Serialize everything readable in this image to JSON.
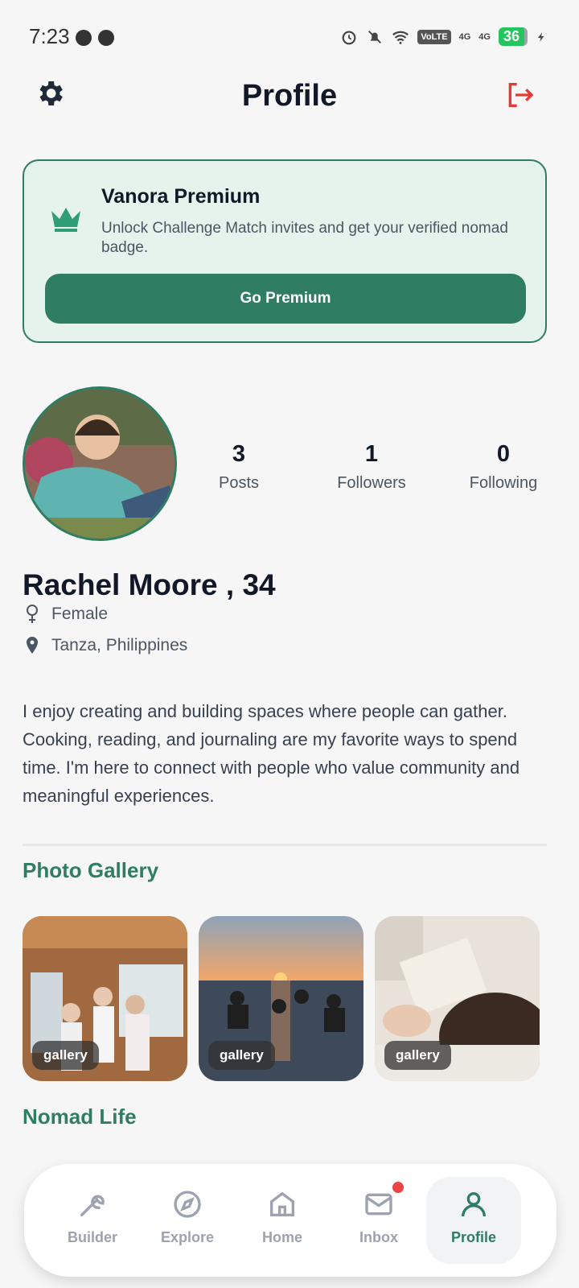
{
  "status_bar": {
    "time": "7:23",
    "battery": "36",
    "volte": "VoLTE",
    "network1": "4G",
    "network2": "4G"
  },
  "header": {
    "title": "Profile",
    "settings_icon": "gear-icon",
    "logout_icon": "logout-icon"
  },
  "premium": {
    "title": "Vanora Premium",
    "description": "Unlock Challenge Match invites and get your verified nomad badge.",
    "button_label": "Go Premium"
  },
  "profile": {
    "stats": [
      {
        "value": "3",
        "label": "Posts"
      },
      {
        "value": "1",
        "label": "Followers"
      },
      {
        "value": "0",
        "label": "Following"
      }
    ],
    "name": "Rachel Moore , 34",
    "gender": "Female",
    "location": "Tanza, Philippines",
    "bio": "I enjoy creating and building spaces where people can gather. Cooking, reading, and journaling are my favorite ways to spend time. I'm here to connect with people who value community and meaningful experiences."
  },
  "gallery": {
    "title": "Photo Gallery",
    "items": [
      {
        "tag": "gallery"
      },
      {
        "tag": "gallery"
      },
      {
        "tag": "gallery"
      }
    ]
  },
  "nomad": {
    "title": "Nomad Life"
  },
  "nav": {
    "items": [
      {
        "label": "Builder",
        "icon": "wrench-icon"
      },
      {
        "label": "Explore",
        "icon": "compass-icon"
      },
      {
        "label": "Home",
        "icon": "home-icon"
      },
      {
        "label": "Inbox",
        "icon": "mail-icon"
      },
      {
        "label": "Profile",
        "icon": "user-icon"
      }
    ],
    "active": "Profile"
  },
  "colors": {
    "accent": "#2f7d62",
    "logout": "#e53935",
    "premium_bg": "#e6f3ec",
    "badge": "#ef4444"
  }
}
